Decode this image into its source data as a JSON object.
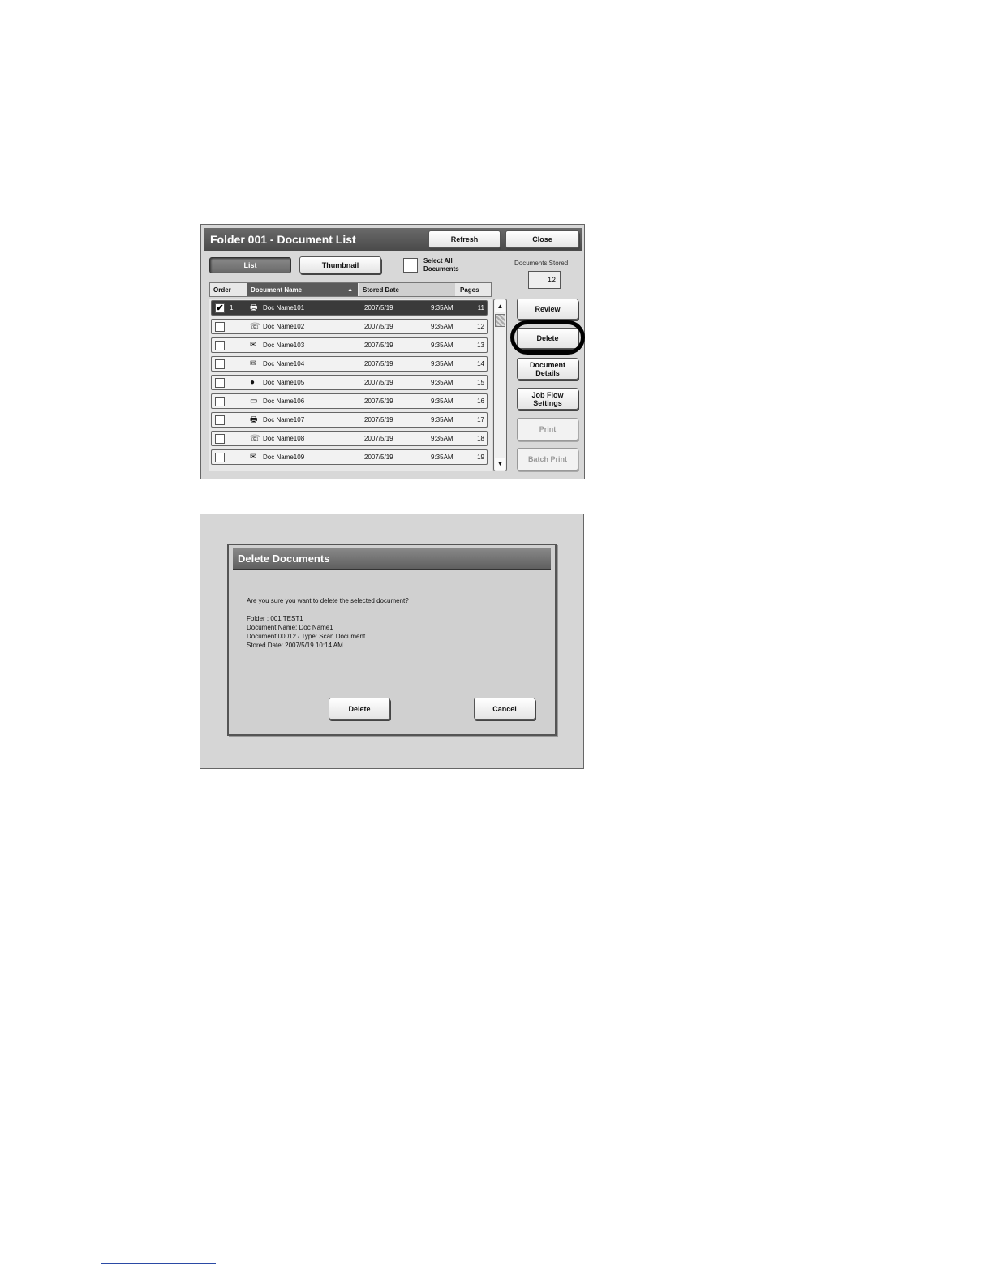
{
  "screen1": {
    "title": "Folder  001 - Document List",
    "buttons": {
      "refresh": "Refresh",
      "close": "Close",
      "list": "List",
      "thumbnail": "Thumbnail",
      "review": "Review",
      "delete": "Delete",
      "document_details": "Document Details",
      "job_flow_settings": "Job Flow Settings",
      "print": "Print",
      "batch_print": "Batch Print"
    },
    "select_all_label": "Select All Documents",
    "documents_stored_label": "Documents Stored",
    "documents_stored_value": "12",
    "columns": {
      "order": "Order",
      "document_name": "Document Name",
      "sort_arrow": "▲",
      "stored_date": "Stored Date",
      "pages": "Pages"
    },
    "rows": [
      {
        "order": "1",
        "name": "Doc Name101",
        "date": "2007/5/19",
        "time": "9:35AM",
        "pages": "11",
        "icon": "printer-icon",
        "selected": true
      },
      {
        "order": "",
        "name": "Doc Name102",
        "date": "2007/5/19",
        "time": "9:35AM",
        "pages": "12",
        "icon": "fax-icon",
        "selected": false
      },
      {
        "order": "",
        "name": "Doc Name103",
        "date": "2007/5/19",
        "time": "9:35AM",
        "pages": "13",
        "icon": "scanner-icon",
        "selected": false
      },
      {
        "order": "",
        "name": "Doc Name104",
        "date": "2007/5/19",
        "time": "9:35AM",
        "pages": "14",
        "icon": "scanner-icon",
        "selected": false
      },
      {
        "order": "",
        "name": "Doc Name105",
        "date": "2007/5/19",
        "time": "9:35AM",
        "pages": "15",
        "icon": "globe-icon",
        "selected": false
      },
      {
        "order": "",
        "name": "Doc Name106",
        "date": "2007/5/19",
        "time": "9:35AM",
        "pages": "16",
        "icon": "computer-icon",
        "selected": false
      },
      {
        "order": "",
        "name": "Doc Name107",
        "date": "2007/5/19",
        "time": "9:35AM",
        "pages": "17",
        "icon": "printer-icon",
        "selected": false
      },
      {
        "order": "",
        "name": "Doc Name108",
        "date": "2007/5/19",
        "time": "9:35AM",
        "pages": "18",
        "icon": "fax-icon",
        "selected": false
      },
      {
        "order": "",
        "name": "Doc Name109",
        "date": "2007/5/19",
        "time": "9:35AM",
        "pages": "19",
        "icon": "scanner-icon",
        "selected": false
      }
    ],
    "scroll_up": "▲",
    "scroll_down": "▼"
  },
  "screen2": {
    "title": "Delete Documents",
    "question": "Are you sure you want to delete the selected document?",
    "details": [
      "Folder : 001 TEST1",
      "Document Name: Doc Name1",
      "Document 00012 / Type: Scan Document",
      "Stored Date: 2007/5/19 10:14 AM"
    ],
    "buttons": {
      "delete": "Delete",
      "cancel": "Cancel"
    }
  }
}
